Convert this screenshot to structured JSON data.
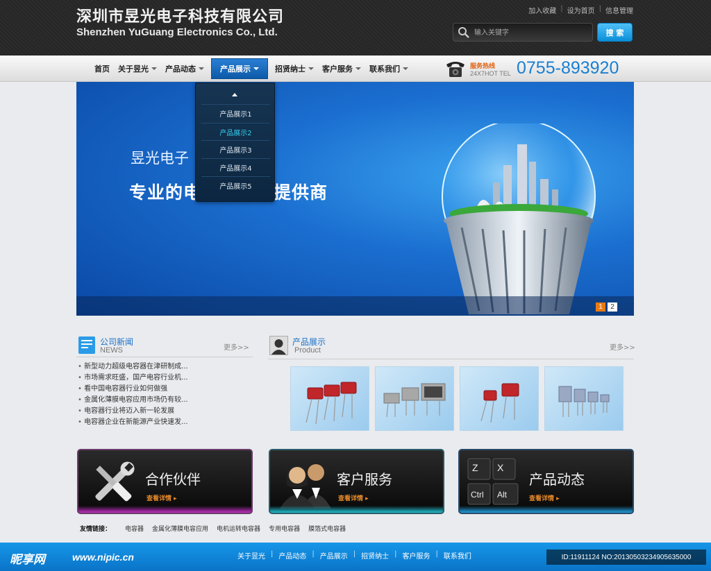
{
  "header": {
    "company_cn": "深圳市昱光电子科技有限公司",
    "company_en": "Shenzhen YuGuang Electronics Co., Ltd.",
    "toplinks": [
      "加入收藏",
      "设为首页",
      "信息管理"
    ],
    "search_placeholder": "输入关键字",
    "search_button": "搜 索"
  },
  "nav": {
    "items": [
      {
        "label": "首页",
        "caret": false
      },
      {
        "label": "关于昱光",
        "caret": true
      },
      {
        "label": "产品动态",
        "caret": true
      },
      {
        "label": "产品展示",
        "caret": true,
        "active": true
      },
      {
        "label": "招贤纳士",
        "caret": true
      },
      {
        "label": "客户服务",
        "caret": true
      },
      {
        "label": "联系我们",
        "caret": true
      }
    ],
    "hotline_label": "服务热线",
    "hotline_sub": "24X7HOT TEL",
    "hotline_number": "0755-893920"
  },
  "dropdown": {
    "items": [
      "产品展示1",
      "产品展示2",
      "产品展示3",
      "产品展示4",
      "产品展示5"
    ],
    "highlighted_index": 1
  },
  "banner": {
    "subtitle": "昱光电子",
    "title": "专业的电容器产品提供商",
    "pages": [
      "1",
      "2"
    ],
    "active_page": 0
  },
  "news": {
    "title": "公司新闻",
    "subtitle": "NEWS",
    "more": "更多>>",
    "items": [
      "新型动力超级电容器在津研制成...",
      "市场需求旺盛，国产电容行业机...",
      "看中国电容器行业如何做强",
      "金属化薄膜电容应用市场仍有较...",
      "电容器行业将迈入新一轮发展",
      "电容器企业在新能源产业快速发..."
    ]
  },
  "products": {
    "title": "产品展示",
    "subtitle": "Product",
    "more": "更多>>",
    "thumbs": [
      "red-capacitors",
      "grey-capacitors",
      "red-capacitors-small",
      "blue-capacitors"
    ]
  },
  "features": [
    {
      "title": "合作伙伴",
      "more": "查看详情",
      "icon": "wrench-screwdriver-icon",
      "glow": "#c030c0"
    },
    {
      "title": "客户服务",
      "more": "查看详情",
      "icon": "customer-service-icon",
      "glow": "#20c0d0"
    },
    {
      "title": "产品动态",
      "more": "查看详情",
      "icon": "keyboard-keys-icon",
      "glow": "#20a0e0",
      "keys": [
        "Z",
        "X",
        "Ctrl",
        "Alt"
      ]
    }
  ],
  "friend_links": {
    "label": "友情链接：",
    "items": [
      "电容器",
      "金属化薄膜电容应用",
      "电机运转电容器",
      "专用电容器",
      "膜箔式电容器"
    ]
  },
  "footer": {
    "links": [
      "关于昱光",
      "产品动态",
      "产品展示",
      "招贤纳士",
      "客户服务",
      "联系我们"
    ]
  },
  "watermark": {
    "logo": "昵享网",
    "url": "www.nipic.cn",
    "id": "ID:11911124 NO:20130503234905635000"
  }
}
